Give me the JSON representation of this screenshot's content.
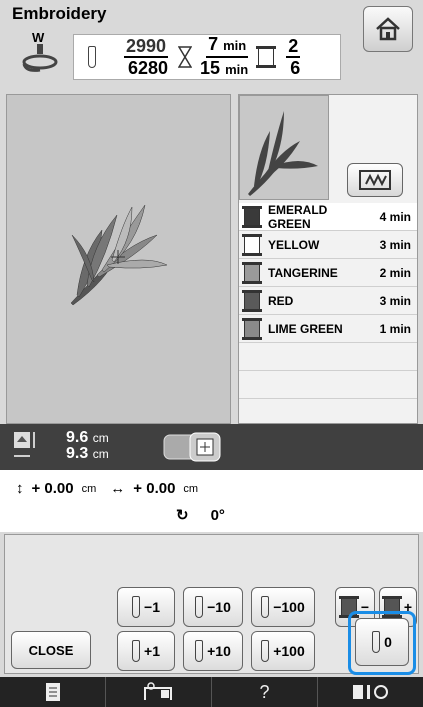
{
  "header": {
    "title": "Embroidery",
    "stitch_current": "2990",
    "stitch_total": "6280",
    "time_current": "7",
    "time_total": "15",
    "time_unit": "min",
    "color_current": "2",
    "color_total": "6",
    "foot_label": "W"
  },
  "colors": [
    {
      "name": "EMERALD GREEN",
      "time": "4 min",
      "swatch": "#3a3a3a"
    },
    {
      "name": "YELLOW",
      "time": "3 min",
      "swatch": "#ffffff"
    },
    {
      "name": "TANGERINE",
      "time": "2 min",
      "swatch": "#9a9a9a"
    },
    {
      "name": "RED",
      "time": "3 min",
      "swatch": "#5a5a5a"
    },
    {
      "name": "LIME GREEN",
      "time": "1 min",
      "swatch": "#8a8a8a"
    }
  ],
  "size": {
    "height": "9.6",
    "width": "9.3",
    "unit": "cm"
  },
  "position": {
    "vertical": "+ 0.00",
    "horizontal": "+ 0.00",
    "unit": "cm",
    "angle": "0°"
  },
  "buttons": {
    "minus1": "−1",
    "minus10": "−10",
    "minus100": "−100",
    "plus1": "+1",
    "plus10": "+10",
    "plus100": "+100",
    "close": "CLOSE",
    "zero": "0",
    "color_minus": "−",
    "color_plus": "+"
  },
  "bottom": {
    "help": "?"
  },
  "accent": "#1a8de6"
}
